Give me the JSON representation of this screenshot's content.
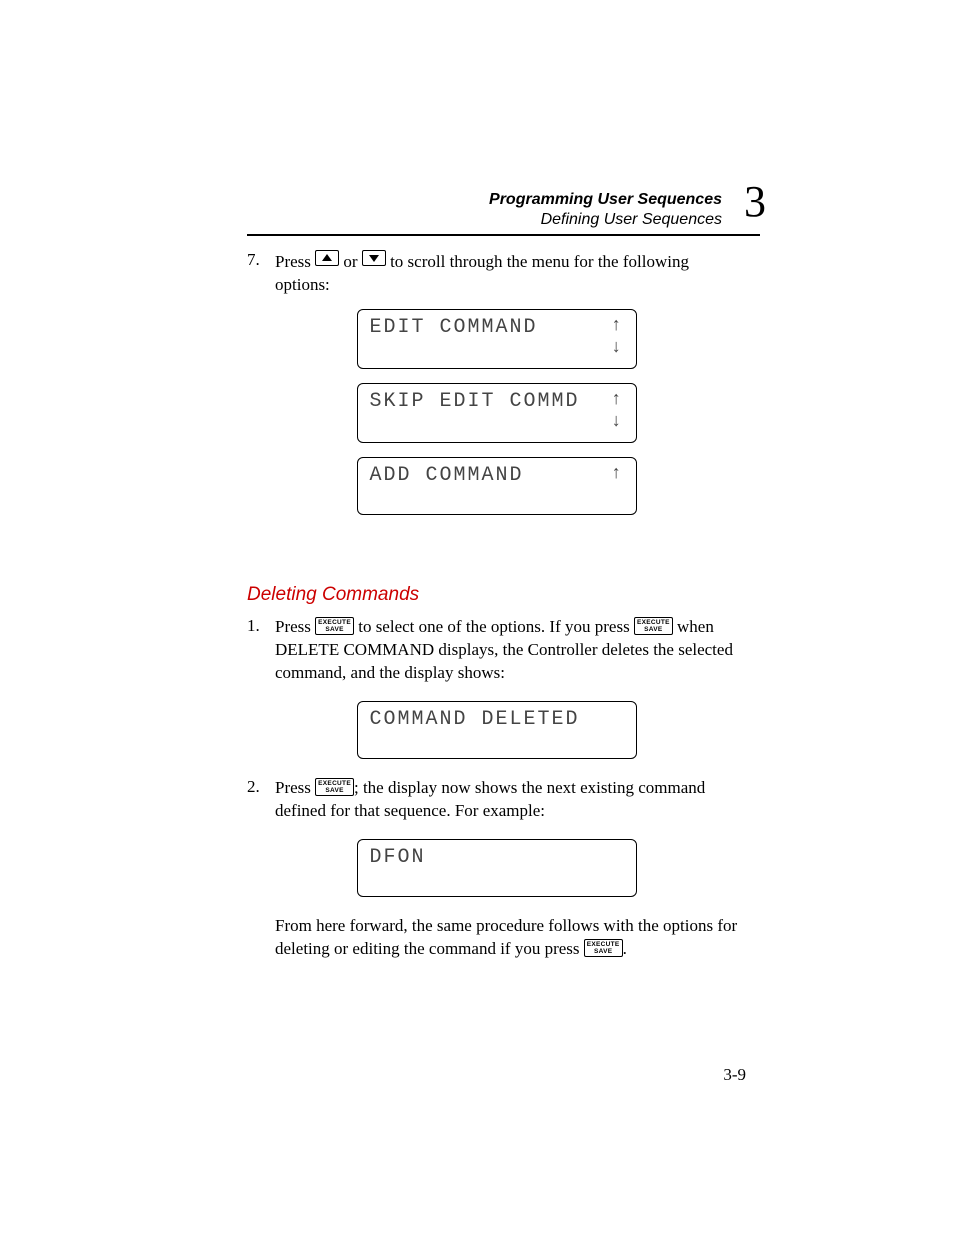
{
  "header": {
    "title": "Programming User Sequences",
    "subtitle": "Defining User Sequences",
    "chapter": "3"
  },
  "step7": {
    "num": "7.",
    "press": "Press ",
    "or": " or ",
    "rest": " to scroll through the menu for the following options:"
  },
  "lcd": {
    "edit": "EDIT COMMAND",
    "skip": "SKIP EDIT COMMD",
    "add": "ADD COMMAND",
    "deleted": "COMMAND DELETED",
    "dfon": "DFON",
    "arrow_up": "↑",
    "arrow_down": "↓"
  },
  "subheading": "Deleting Commands",
  "exec_key": {
    "l1": "EXECUTE",
    "l2": "SAVE"
  },
  "step1": {
    "num": "1.",
    "press": "Press ",
    "mid": " to select one of the options. If you press ",
    "tail": " when DELETE COMMAND displays, the Controller deletes the selected command, and the display shows:"
  },
  "step2": {
    "num": "2.",
    "press": "Press ",
    "tail": "; the display now shows the next existing command defined for that sequence. For example:"
  },
  "closing": {
    "a": "From here forward, the same procedure follows with the options for deleting or editing the command if you press ",
    "b": "."
  },
  "page_number": "3-9"
}
